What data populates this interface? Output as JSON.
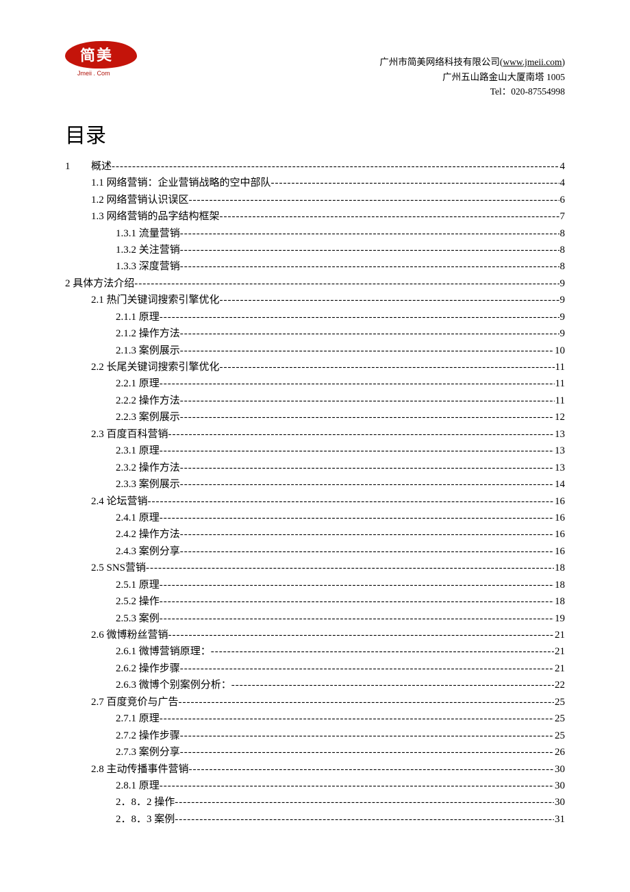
{
  "header": {
    "logo_text": "简美",
    "logo_sub": "Jmeii . Com",
    "company_line1_pre": "广州市简美网络科技有限公司(",
    "company_link": "www.jmeii.com",
    "company_line1_post": ")",
    "company_line2": "广州五山路金山大厦南塔 1005",
    "company_line3": "Tel：020-87554998"
  },
  "toc_title": "目录",
  "toc": [
    {
      "level": 1,
      "num": "1",
      "label": "概述",
      "page": "4"
    },
    {
      "level": 2,
      "num": "1.1",
      "label": " 网络营销：企业营销战略的空中部队 ",
      "page": " 4"
    },
    {
      "level": 2,
      "num": "1.2",
      "label": " 网络营销认识误区 ",
      "page": " 6"
    },
    {
      "level": 2,
      "num": "1.3",
      "label": " 网络营销的品字结构框架 ",
      "page": " 7"
    },
    {
      "level": 3,
      "num": "1.3.1",
      "label": " 流量营销 ",
      "page": " 8"
    },
    {
      "level": 3,
      "num": "1.3.2",
      "label": " 关注营销 ",
      "page": " 8"
    },
    {
      "level": 3,
      "num": "1.3.3",
      "label": " 深度营销 ",
      "page": " 8"
    },
    {
      "level": 1,
      "num": "2",
      "label": " 具体方法介绍",
      "page": " 9",
      "inline": true
    },
    {
      "level": 2,
      "num": "2.1",
      "label": " 热门关键词搜索引擎优化 ",
      "page": " 9"
    },
    {
      "level": 3,
      "num": "2.1.1",
      "label": " 原理 ",
      "page": " 9"
    },
    {
      "level": 3,
      "num": "2.1.2",
      "label": " 操作方法 ",
      "page": " 9"
    },
    {
      "level": 3,
      "num": "2.1.3",
      "label": " 案例展示 ",
      "page": "10"
    },
    {
      "level": 2,
      "num": "2.2",
      "label": " 长尾关键词搜索引擎优化 ",
      "page": " 11"
    },
    {
      "level": 3,
      "num": "2.2.1",
      "label": " 原理 ",
      "page": " 11"
    },
    {
      "level": 3,
      "num": "2.2.2",
      "label": " 操作方法 ",
      "page": " 11"
    },
    {
      "level": 3,
      "num": "2.2.3",
      "label": " 案例展示 ",
      "page": "12"
    },
    {
      "level": 2,
      "num": "2.3",
      "label": " 百度百科营销 ",
      "page": "13"
    },
    {
      "level": 3,
      "num": "2.3.1",
      "label": " 原理 ",
      "page": "13"
    },
    {
      "level": 3,
      "num": "2.3.2",
      "label": " 操作方法 ",
      "page": "13"
    },
    {
      "level": 3,
      "num": "2.3.3",
      "label": " 案例展示 ",
      "page": "14"
    },
    {
      "level": 2,
      "num": "2.4",
      "label": " 论坛营销 ",
      "page": "16"
    },
    {
      "level": 3,
      "num": "2.4.1",
      "label": " 原理 ",
      "page": "16"
    },
    {
      "level": 3,
      "num": "2.4.2",
      "label": " 操作方法 ",
      "page": "16"
    },
    {
      "level": 3,
      "num": "2.4.3",
      "label": " 案例分享 ",
      "page": "16"
    },
    {
      "level": 2,
      "num": "2.5",
      "label": " SNS营销",
      "page": "18"
    },
    {
      "level": 3,
      "num": "2.5.1",
      "label": " 原理 ",
      "page": "18"
    },
    {
      "level": 3,
      "num": "2.5.2",
      "label": " 操作 ",
      "page": "18"
    },
    {
      "level": 3,
      "num": "2.5.3",
      "label": " 案例 ",
      "page": "19"
    },
    {
      "level": 2,
      "num": "2.6",
      "label": " 微博粉丝营销 ",
      "page": "21"
    },
    {
      "level": 3,
      "num": "2.6.1",
      "label": " 微博营销原理：",
      "page": "21"
    },
    {
      "level": 3,
      "num": "2.6.2",
      "label": " 操作步骤 ",
      "page": "21"
    },
    {
      "level": 3,
      "num": "2.6.3",
      "label": " 微博个别案例分析：",
      "page": "22"
    },
    {
      "level": 2,
      "num": "2.7",
      "label": " 百度竞价与广告 ",
      "page": "25"
    },
    {
      "level": 3,
      "num": "2.7.1",
      "label": " 原理 ",
      "page": "25"
    },
    {
      "level": 3,
      "num": "2.7.2",
      "label": " 操作步骤 ",
      "page": "25"
    },
    {
      "level": 3,
      "num": "2.7.3",
      "label": " 案例分享 ",
      "page": "26"
    },
    {
      "level": 2,
      "num": "2.8",
      "label": " 主动传播事件营销 ",
      "page": "30"
    },
    {
      "level": 3,
      "num": "2.8.1",
      "label": " 原理 ",
      "page": "30"
    },
    {
      "level": 3,
      "num": "2．8．2",
      "label": " 操作 ",
      "page": "30"
    },
    {
      "level": 3,
      "num": "2．8．3",
      "label": " 案例 ",
      "page": "31"
    }
  ]
}
